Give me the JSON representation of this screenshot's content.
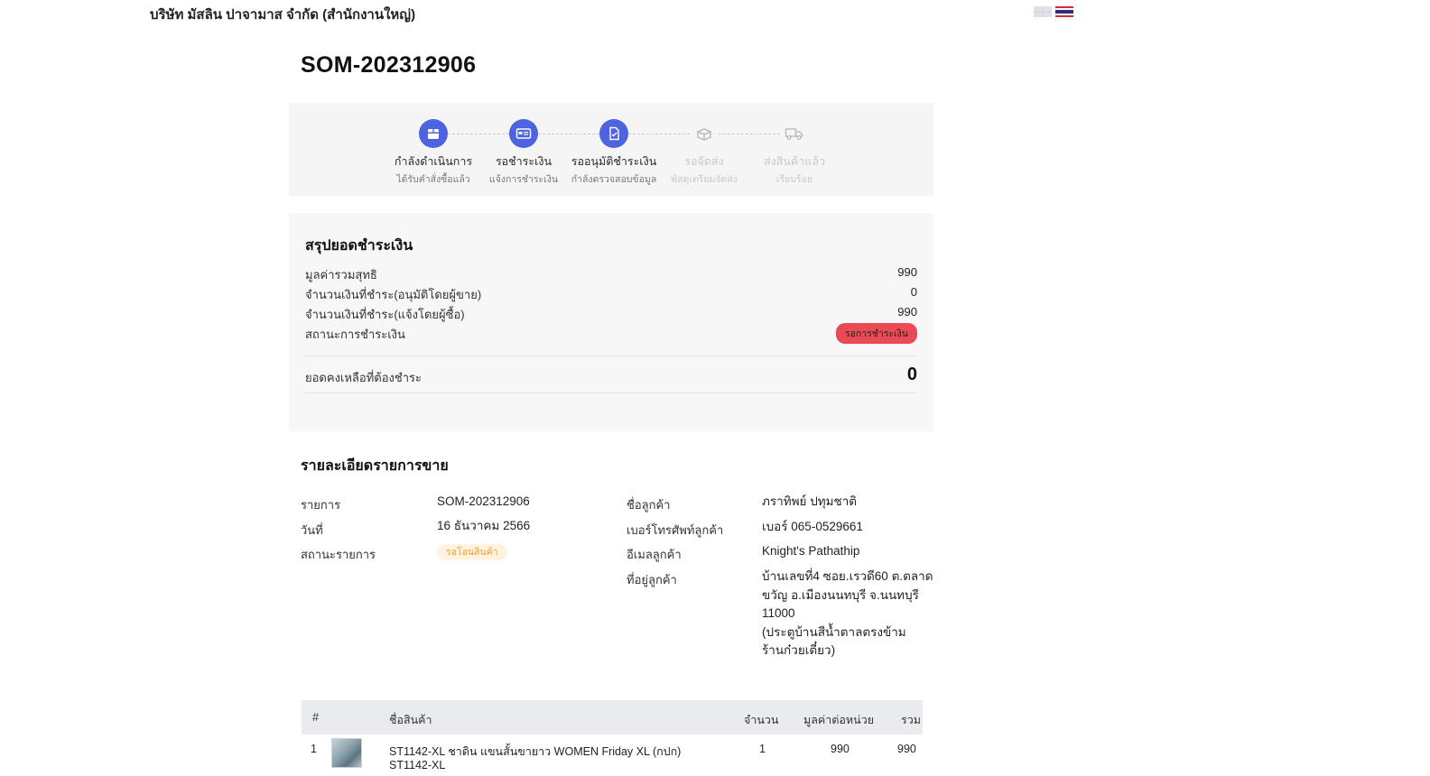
{
  "header": {
    "company": "บริษัท มัสลิน ปาจามาส จำกัด (สำนักงานใหญ่)",
    "flags": [
      {
        "icon": "uk-flag-icon"
      },
      {
        "icon": "thai-flag-icon"
      }
    ]
  },
  "order": {
    "number": "SOM-202312906"
  },
  "progress": {
    "steps": [
      {
        "icon": "box-icon",
        "label": "กำลังดำเนินการ",
        "sub": "ได้รับคำสั่งซื้อแล้ว",
        "active": true
      },
      {
        "icon": "payment-card-icon",
        "label": "รอชำระเงิน",
        "sub": "แจ้งการชำระเงิน",
        "active": true
      },
      {
        "icon": "document-check-icon",
        "label": "รออนุมัติชำระเงิน",
        "sub": "กำลังตรวจสอบข้อมูล",
        "active": true
      },
      {
        "icon": "gift-box-icon",
        "label": "รอจัดส่ง",
        "sub": "พัสดุเตรียมจัดส่ง",
        "active": false
      },
      {
        "icon": "truck-icon",
        "label": "ส่งสินค้าแล้ว",
        "sub": "เรียบร้อย",
        "active": false
      }
    ]
  },
  "summary": {
    "title": "สรุปยอดชำระเงิน",
    "net_total_label": "มูลค่ารวมสุทธิ",
    "net_total": "990",
    "paid_seller_label": "จำนวนเงินที่ชำระ(อนุมัติโดยผู้ขาย)",
    "paid_seller": "0",
    "paid_buyer_label": "จำนวนเงินที่ชำระ(แจ้งโดยผู้ซื้อ)",
    "paid_buyer": "990",
    "status_label": "สถานะการชำระเงิน",
    "status": "รอการชำระเงิน",
    "status_color": "#ea4a55",
    "balance_label": "ยอดคงเหลือที่ต้องชำระ",
    "balance": "0"
  },
  "details": {
    "title": "รายละเอียดรายการขาย",
    "item_label": "รายการ",
    "item": "SOM-202312906",
    "date_label": "วันที่",
    "date": "16 ธันวาคม 2566",
    "status_label": "สถานะรายการ",
    "status": "รอโอนสินค้า",
    "status_color": "#f0a030",
    "customer_label": "ชื่อลูกค้า",
    "customer": "ภราทิพย์ ปทุมชาติ",
    "phone_label": "เบอร์โทรศัพท์ลูกค้า",
    "phone": "เบอร์ 065-0529661",
    "email_label": "อีเมลลูกค้า",
    "email": "Knight's Pathathip",
    "address_label": "ที่อยู่ลูกค้า",
    "address_lines": [
      "บ้านเลขที่4 ซอย.เรวดี60 ต.ตลาด",
      "ขวัญ อ.เมืองนนทบุรี จ.นนทบุรี",
      "11000",
      "(ประตูบ้านสีน้ำตาลตรงข้าม",
      "ร้านก๋วยเตี๋ยว)"
    ]
  },
  "table": {
    "headers": {
      "index": "#",
      "name": "ชื่อสินค้า",
      "qty": "จำนวน",
      "unit_price": "มูลค่าต่อหน่วย",
      "total": "รวม"
    },
    "rows": [
      {
        "index": "1",
        "name": "ST1142-XL ชาดิน แขนสั้นขายาว WOMEN Friday XL (กปก)",
        "sku": "ST1142-XL",
        "qty": "1",
        "unit_price": "990",
        "total": "990"
      }
    ]
  }
}
